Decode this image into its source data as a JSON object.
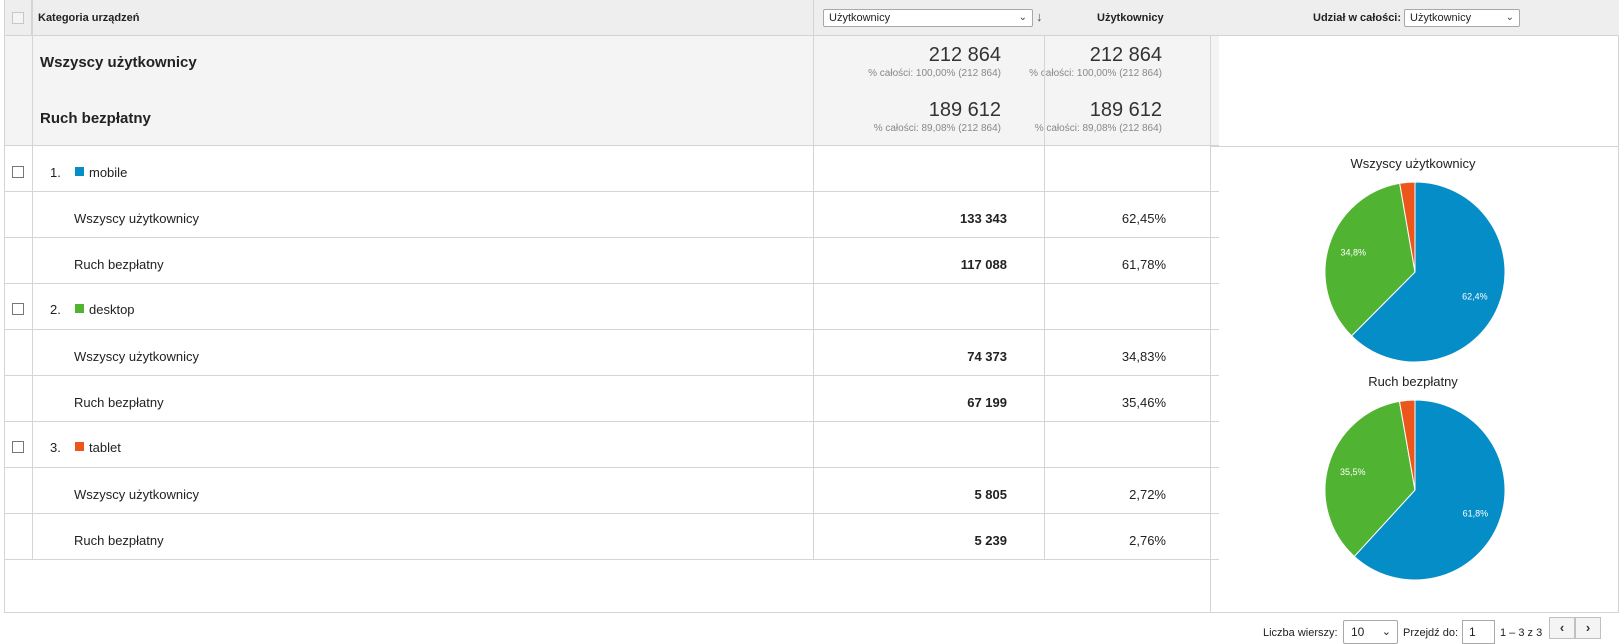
{
  "header": {
    "dimension_label": "Kategoria urządzeń",
    "metric_select": "Użytkownicy",
    "metric_column": "Użytkownicy",
    "share_label": "Udział w całości:",
    "share_select": "Użytkownicy"
  },
  "summary": [
    {
      "label": "Wszyscy użytkownicy",
      "value1": "212 864",
      "note1": "% całości: 100,00% (212 864)",
      "value2": "212 864",
      "note2": "% całości: 100,00% (212 864)"
    },
    {
      "label": "Ruch bezpłatny",
      "value1": "189 612",
      "note1": "% całości: 89,08% (212 864)",
      "value2": "189 612",
      "note2": "% całości: 89,08% (212 864)"
    }
  ],
  "rows": [
    {
      "rank": "1.",
      "name": "mobile",
      "color": "#058dc7",
      "segments": [
        {
          "label": "Wszyscy użytkownicy",
          "value": "133 343",
          "share": "62,45%"
        },
        {
          "label": "Ruch bezpłatny",
          "value": "117 088",
          "share": "61,78%"
        }
      ]
    },
    {
      "rank": "2.",
      "name": "desktop",
      "color": "#50b432",
      "segments": [
        {
          "label": "Wszyscy użytkownicy",
          "value": "74 373",
          "share": "34,83%"
        },
        {
          "label": "Ruch bezpłatny",
          "value": "67 199",
          "share": "35,46%"
        }
      ]
    },
    {
      "rank": "3.",
      "name": "tablet",
      "color": "#ed561b",
      "segments": [
        {
          "label": "Wszyscy użytkownicy",
          "value": "5 805",
          "share": "2,72%"
        },
        {
          "label": "Ruch bezpłatny",
          "value": "5 239",
          "share": "2,76%"
        }
      ]
    }
  ],
  "chart_data": [
    {
      "type": "pie",
      "title": "Wszyscy użytkownicy",
      "categories": [
        "mobile",
        "desktop",
        "tablet"
      ],
      "values": [
        62.45,
        34.83,
        2.72
      ],
      "labels": [
        "62,4%",
        "34,8%",
        ""
      ],
      "colors": [
        "#058dc7",
        "#50b432",
        "#ed561b"
      ]
    },
    {
      "type": "pie",
      "title": "Ruch bezpłatny",
      "categories": [
        "mobile",
        "desktop",
        "tablet"
      ],
      "values": [
        61.78,
        35.46,
        2.76
      ],
      "labels": [
        "61,8%",
        "35,5%",
        ""
      ],
      "colors": [
        "#058dc7",
        "#50b432",
        "#ed561b"
      ]
    }
  ],
  "footer": {
    "rows_label": "Liczba wierszy:",
    "rows_value": "10",
    "goto_label": "Przejdź do:",
    "goto_value": "1",
    "range": "1 – 3 z 3",
    "prev": "‹",
    "next": "›"
  }
}
